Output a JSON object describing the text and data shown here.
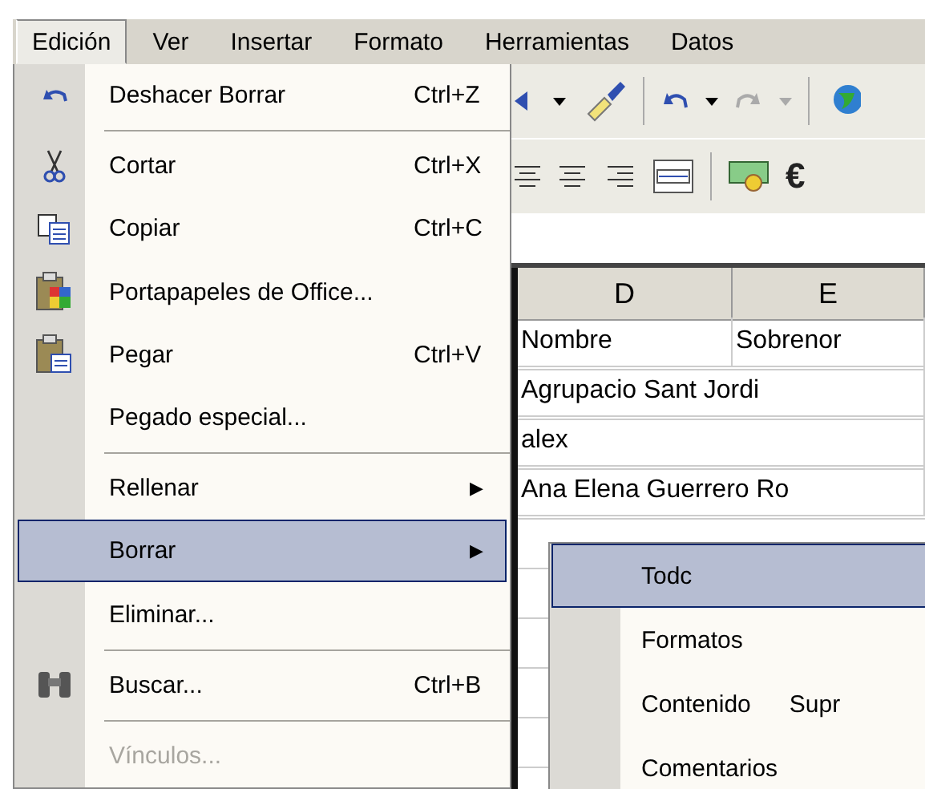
{
  "menubar": [
    {
      "label": "Edición",
      "selected": true
    },
    {
      "label": "Ver",
      "selected": false
    },
    {
      "label": "Insertar",
      "selected": false
    },
    {
      "label": "Formato",
      "selected": false
    },
    {
      "label": "Herramientas",
      "selected": false
    },
    {
      "label": "Datos",
      "selected": false
    }
  ],
  "menu": [
    {
      "kind": "item",
      "label": "Deshacer Borrar",
      "shortcut": "Ctrl+Z",
      "disabled": false,
      "selected": false
    },
    {
      "kind": "separator"
    },
    {
      "kind": "item",
      "label": "Cortar",
      "shortcut": "Ctrl+X",
      "disabled": false,
      "selected": false
    },
    {
      "kind": "item",
      "label": "Copiar",
      "shortcut": "Ctrl+C",
      "disabled": false,
      "selected": false
    },
    {
      "kind": "item",
      "label": "Portapapeles de Office...",
      "disabled": false,
      "selected": false
    },
    {
      "kind": "item",
      "label": "Pegar",
      "shortcut": "Ctrl+V",
      "disabled": false,
      "selected": false
    },
    {
      "kind": "item",
      "label": "Pegado especial...",
      "disabled": false,
      "selected": false
    },
    {
      "kind": "separator"
    },
    {
      "kind": "item",
      "label": "Rellenar",
      "arrow": "▶",
      "disabled": false,
      "selected": false
    },
    {
      "kind": "item",
      "label": "Borrar",
      "arrow": "▶",
      "disabled": false,
      "selected": true
    },
    {
      "kind": "item",
      "label": "Eliminar...",
      "disabled": false,
      "selected": false
    },
    {
      "kind": "separator"
    },
    {
      "kind": "item",
      "label": "Buscar...",
      "shortcut": "Ctrl+B",
      "disabled": false,
      "selected": false
    },
    {
      "kind": "separator"
    },
    {
      "kind": "item",
      "label": "Vínculos...",
      "disabled": true,
      "selected": false
    }
  ],
  "submenu": [
    {
      "label": "Todc",
      "selected": true
    },
    {
      "label": "Formatos",
      "selected": false
    },
    {
      "label": "Contenido",
      "shortcut": "Supr",
      "selected": false
    },
    {
      "label": "Comentarios",
      "selected": false
    }
  ],
  "toolbar": {
    "euro": "€"
  },
  "sheet": {
    "columns": [
      "D",
      "E"
    ],
    "rows": [
      [
        "Nombre",
        "Sobrenor"
      ],
      [
        "Agrupacio Sant Jordi"
      ],
      [
        "alex"
      ],
      [
        "Ana Elena Guerrero Ro"
      ]
    ]
  }
}
